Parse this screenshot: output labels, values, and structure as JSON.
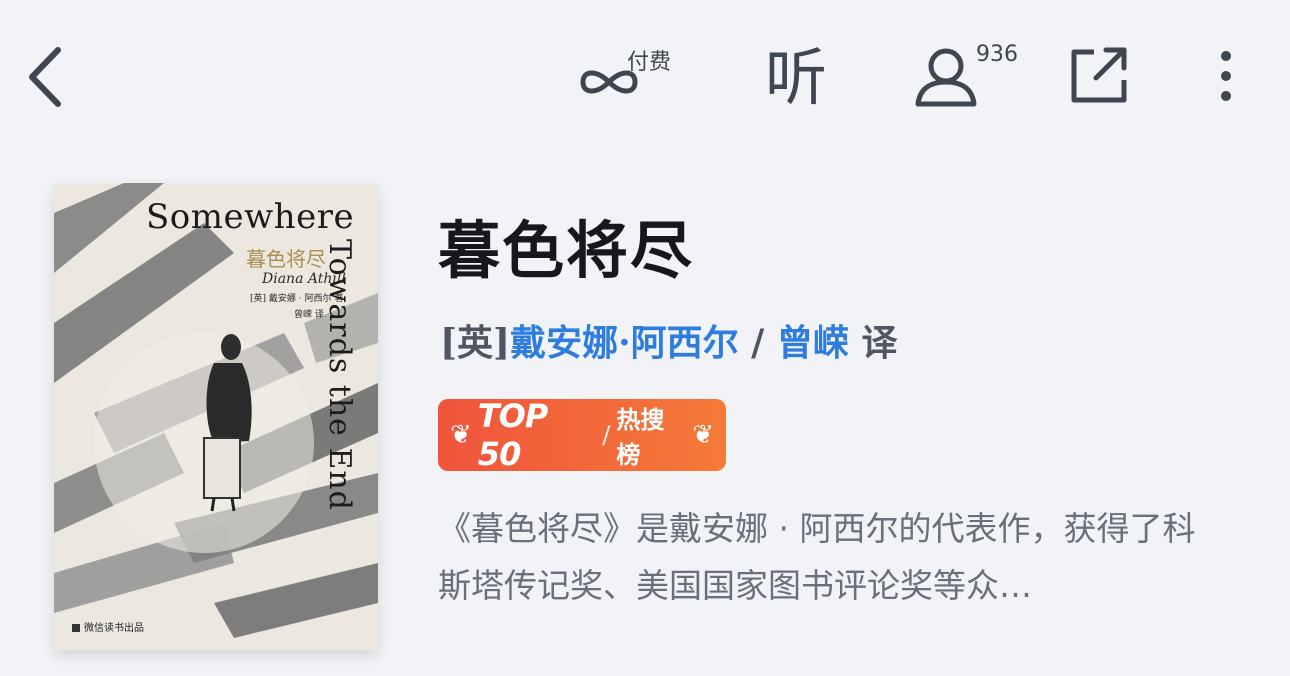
{
  "toolbar": {
    "paid_label": "付费",
    "listen_label": "听",
    "readers_count": "936"
  },
  "icons": {
    "back": "chevron-left-icon",
    "paid": "infinity-icon",
    "listen": "listen-icon",
    "readers": "user-icon",
    "share": "share-external-icon",
    "more": "more-vertical-icon"
  },
  "book": {
    "title": "暮色将尽",
    "author_prefix": "[英]",
    "author_name": "戴安娜·阿西尔",
    "separator": " / ",
    "translator_name": "曾嵘",
    "translator_suffix": " 译",
    "intro": "《暮色将尽》是戴安娜 · 阿西尔的代表作，获得了科斯塔传记奖、美国国家图书评论奖等众…"
  },
  "cover": {
    "title_en": "Somewhere",
    "title_en_vertical": "Towards the End",
    "title_cn": "暮色将尽",
    "author_en": "Diana Athill",
    "author_cn": "[英] 戴安娜 · 阿西尔  著",
    "translator_cn": "曾嵘  译",
    "publisher": "微信读书出品"
  },
  "rank_badge": {
    "top_label": "TOP 50",
    "slash": "/",
    "list_name": "热搜榜"
  },
  "colors": {
    "background": "#f1f3f6",
    "link_blue": "#2e7dde",
    "badge_start": "#f0543c",
    "badge_end": "#f57a38",
    "icon_gray": "#3f4650"
  }
}
